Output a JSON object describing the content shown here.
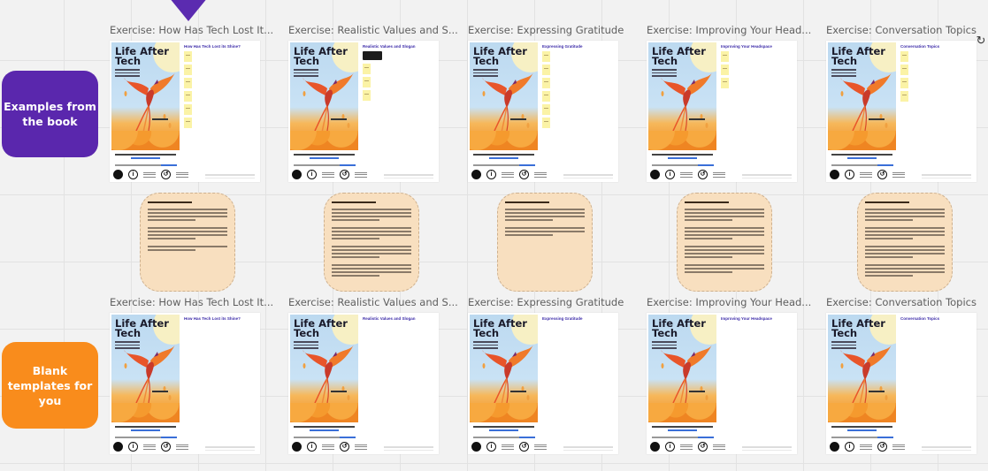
{
  "board": {
    "labels": {
      "examples": "Examples from the book",
      "blank": "Blank templates for you"
    },
    "cover": {
      "title_line1": "Life After",
      "title_line2": "Tech"
    },
    "colors": {
      "examples_label": "#5a27ad",
      "blank_label": "#f98c1c",
      "sticky_note": "#f8dfbf",
      "arrow": "#5b2bb0"
    },
    "examples_row": [
      {
        "title": "Exercise: How Has Tech Lost It...",
        "inner_title": "How Has Tech Lost its Shine?"
      },
      {
        "title": "Exercise: Realistic Values and S...",
        "inner_title": "Realistic Values and Slogan"
      },
      {
        "title": "Exercise: Expressing Gratitude",
        "inner_title": "Expressing Gratitude"
      },
      {
        "title": "Exercise: Improving Your Head...",
        "inner_title": "Improving Your Headspace"
      },
      {
        "title": "Exercise: Conversation Topics",
        "inner_title": "Conversation Topics"
      }
    ],
    "blank_row": [
      {
        "title": "Exercise: How Has Tech Lost It...",
        "inner_title": "How Has Tech Lost its Shine?"
      },
      {
        "title": "Exercise: Realistic Values and S...",
        "inner_title": "Realistic Values and Slogan"
      },
      {
        "title": "Exercise: Expressing Gratitude",
        "inner_title": "Expressing Gratitude"
      },
      {
        "title": "Exercise: Improving Your Head...",
        "inner_title": "Improving Your Headspace"
      },
      {
        "title": "Exercise: Conversation Topics",
        "inner_title": "Conversation Topics"
      }
    ],
    "icons": {
      "rotate": "rotate-icon",
      "cc_by": "cc-by-icon",
      "cc_sa": "cc-sa-icon"
    }
  }
}
